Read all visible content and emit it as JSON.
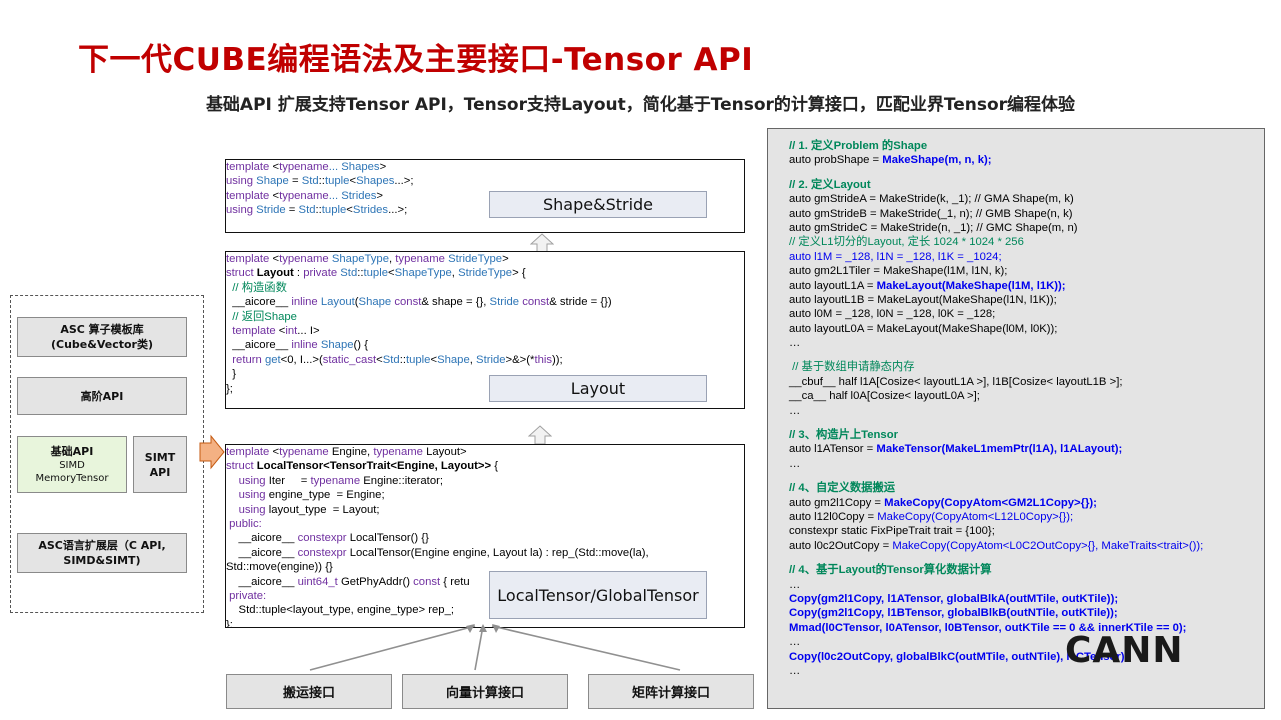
{
  "title": "下一代CUBE编程语法及主要接口-Tensor API",
  "subtitle": "基础API 扩展支持Tensor API，Tensor支持Layout，简化基于Tensor的计算接口，匹配业界Tensor编程体验",
  "arch": {
    "asc_lib": "ASC 算子模板库",
    "asc_lib_sub": "(Cube&Vector类)",
    "high_api": "高阶API",
    "basic_api": "基础API",
    "basic_api_simd": "SIMD",
    "basic_api_mem": "MemoryTensor",
    "simt_api_1": "SIMT",
    "simt_api_2": "API",
    "ext_layer_1": "ASC语言扩展层（C API,",
    "ext_layer_2": "SIMD&SIMT)"
  },
  "labels": {
    "shape_stride": "Shape&Stride",
    "layout": "Layout",
    "local_tensor": "LocalTensor/GlobalTensor"
  },
  "bottom_buttons": [
    "搬运接口",
    "向量计算接口",
    "矩阵计算接口"
  ],
  "code_shape": [
    [
      [
        "kw",
        "template "
      ],
      [
        "",
        "<"
      ],
      [
        "kw",
        "typename"
      ],
      [
        "ty",
        "... Shapes"
      ],
      [
        "",
        ">"
      ]
    ],
    [
      [
        "kw",
        "using "
      ],
      [
        "ty",
        "Shape"
      ],
      [
        "",
        " = "
      ],
      [
        "ty",
        "Std"
      ],
      [
        "",
        "::"
      ],
      [
        "ty",
        "tuple"
      ],
      [
        "",
        "<"
      ],
      [
        "ty",
        "Shapes"
      ],
      [
        "",
        "...>;"
      ]
    ],
    [
      [
        "kw",
        "template "
      ],
      [
        "",
        "<"
      ],
      [
        "kw",
        "typename"
      ],
      [
        "ty",
        "... Strides"
      ],
      [
        "",
        ">"
      ]
    ],
    [
      [
        "kw",
        "using "
      ],
      [
        "ty",
        "Stride"
      ],
      [
        "",
        " = "
      ],
      [
        "ty",
        "Std"
      ],
      [
        "",
        "::"
      ],
      [
        "ty",
        "tuple"
      ],
      [
        "",
        "<"
      ],
      [
        "ty",
        "Strides"
      ],
      [
        "",
        "...>;"
      ]
    ]
  ],
  "code_layout": [
    [
      [
        "kw",
        "template "
      ],
      [
        "",
        "<"
      ],
      [
        "kw",
        "typename "
      ],
      [
        "ty",
        "ShapeType"
      ],
      [
        "",
        ", "
      ],
      [
        "kw",
        "typename "
      ],
      [
        "ty",
        "StrideType"
      ],
      [
        "",
        ">"
      ]
    ],
    [
      [
        "kw",
        "struct "
      ],
      [
        "bold",
        "Layout"
      ],
      [
        "",
        " : "
      ],
      [
        "kw",
        "private "
      ],
      [
        "ty",
        "Std"
      ],
      [
        "",
        "::"
      ],
      [
        "ty",
        "tuple"
      ],
      [
        "",
        "<"
      ],
      [
        "ty",
        "ShapeType"
      ],
      [
        "",
        ", "
      ],
      [
        "ty",
        "StrideType"
      ],
      [
        "",
        "> {"
      ]
    ],
    [
      [
        "cm",
        "  // 构造函数"
      ]
    ],
    [
      [
        "",
        "  __aicore__ "
      ],
      [
        "kw",
        "inline "
      ],
      [
        "ty",
        "Layout"
      ],
      [
        "",
        "("
      ],
      [
        "ty",
        "Shape "
      ],
      [
        "kw",
        "const"
      ],
      [
        "",
        "& shape = {}, "
      ],
      [
        "ty",
        "Stride "
      ],
      [
        "kw",
        "const"
      ],
      [
        "",
        "& stride = {})"
      ]
    ],
    [
      [
        "cm",
        "  // 返回Shape"
      ]
    ],
    [
      [
        "",
        "  "
      ],
      [
        "kw",
        "template "
      ],
      [
        "",
        "<"
      ],
      [
        "kw",
        "int"
      ],
      [
        "",
        "... I>"
      ]
    ],
    [
      [
        "",
        "  __aicore__ "
      ],
      [
        "kw",
        "inline "
      ],
      [
        "ty",
        "Shape"
      ],
      [
        "",
        "() {"
      ]
    ],
    [
      [
        "",
        "  "
      ],
      [
        "kw",
        "return "
      ],
      [
        "ty",
        "get"
      ],
      [
        "",
        "<0, I...>("
      ],
      [
        "kw",
        "static_cast"
      ],
      [
        "",
        "<"
      ],
      [
        "ty",
        "Std"
      ],
      [
        "",
        "::"
      ],
      [
        "ty",
        "tuple"
      ],
      [
        "",
        "<"
      ],
      [
        "ty",
        "Shape"
      ],
      [
        "",
        ", "
      ],
      [
        "ty",
        "Stride"
      ],
      [
        "",
        ">&>(*"
      ],
      [
        "kw",
        "this"
      ],
      [
        "",
        "));"
      ]
    ],
    [
      [
        "",
        "  }"
      ]
    ],
    [
      [
        "",
        "};"
      ]
    ]
  ],
  "code_tensor": [
    [
      [
        "kw",
        "template "
      ],
      [
        "",
        "<"
      ],
      [
        "kw",
        "typename "
      ],
      [
        "",
        "Engine, "
      ],
      [
        "kw",
        "typename "
      ],
      [
        "",
        "Layout>"
      ]
    ],
    [
      [
        "kw",
        "struct "
      ],
      [
        "bold",
        "LocalTensor<TensorTrait<Engine, Layout>>"
      ],
      [
        "",
        " {"
      ]
    ],
    [
      [
        "",
        "    "
      ],
      [
        "kw",
        "using "
      ],
      [
        "",
        "Iter     = "
      ],
      [
        "kw",
        "typename "
      ],
      [
        "",
        "Engine::iterator;"
      ]
    ],
    [
      [
        "",
        "    "
      ],
      [
        "kw",
        "using "
      ],
      [
        "",
        "engine_type  = Engine;"
      ]
    ],
    [
      [
        "",
        "    "
      ],
      [
        "kw",
        "using "
      ],
      [
        "",
        "layout_type  = Layout;"
      ]
    ],
    [
      [
        "kw",
        " public:"
      ]
    ],
    [
      [
        "",
        "    __aicore__ "
      ],
      [
        "kw",
        "constexpr "
      ],
      [
        "",
        "LocalTensor() {}"
      ]
    ],
    [
      [
        "",
        "    __aicore__ "
      ],
      [
        "kw",
        "constexpr "
      ],
      [
        "",
        "LocalTensor(Engine engine, Layout la) : rep_(Std::move(la),"
      ]
    ],
    [
      [
        "",
        "Std::move(engine)) {}"
      ]
    ],
    [
      [
        "",
        "    __aicore__ "
      ],
      [
        "kw",
        "uint64_t "
      ],
      [
        "",
        "GetPhyAddr() "
      ],
      [
        "kw",
        "const "
      ],
      [
        "",
        "{ retu"
      ]
    ],
    [
      [
        "kw",
        " private:"
      ]
    ],
    [
      [
        "",
        "    Std::tuple<layout_type, engine_type> rep_;"
      ]
    ],
    [
      [
        "",
        "};"
      ]
    ]
  ],
  "right_code": [
    [
      [
        "r-cm",
        "// 1. 定义Problem 的Shape"
      ]
    ],
    [
      [
        "",
        "auto probShape = "
      ],
      [
        "r-blue",
        "MakeShape(m, n, k);"
      ]
    ],
    [],
    [
      [
        "r-cm",
        "// 2. 定义Layout"
      ]
    ],
    [
      [
        "",
        "auto gmStrideA = MakeStride(k, _1); // GMA Shape(m, k)"
      ]
    ],
    [
      [
        "",
        "auto gmStrideB = MakeStride(_1, n); // GMB Shape(n, k)"
      ]
    ],
    [
      [
        "",
        "auto gmStrideC = MakeStride(n, _1); // GMC Shape(m, n)"
      ]
    ],
    [
      [
        "r-cm2",
        "// 定义L1切分的Layout, 定长 1024 * 1024 * 256"
      ]
    ],
    [
      [
        "r-blue2",
        "auto l1M = _128, l1N = _128, l1K = _1024;"
      ]
    ],
    [
      [
        "",
        "auto gm2L1Tiler = MakeShape(l1M, l1N, k);"
      ]
    ],
    [
      [
        "",
        "auto layoutL1A = "
      ],
      [
        "r-blue",
        "MakeLayout(MakeShape(l1M, l1K));"
      ]
    ],
    [
      [
        "",
        "auto layoutL1B = MakeLayout(MakeShape(l1N, l1K));"
      ]
    ],
    [
      [
        "",
        "auto l0M = _128, l0N = _128, l0K = _128;"
      ]
    ],
    [
      [
        "",
        "auto layoutL0A = MakeLayout(MakeShape(l0M, l0K));"
      ]
    ],
    [
      [
        "",
        "…"
      ]
    ],
    [],
    [
      [
        "r-cm2",
        " // 基于数组申请静态内存"
      ]
    ],
    [
      [
        "",
        "__cbuf__ half l1A[Cosize< layoutL1A >], l1B[Cosize< layoutL1B >];"
      ]
    ],
    [
      [
        "",
        "__ca__ half l0A[Cosize< layoutL0A >];"
      ]
    ],
    [
      [
        "",
        "…"
      ]
    ],
    [],
    [
      [
        "r-cm",
        "// 3、构造片上Tensor"
      ]
    ],
    [
      [
        "",
        "auto l1ATensor = "
      ],
      [
        "r-blue",
        "MakeTensor(MakeL1memPtr(l1A), l1ALayout);"
      ]
    ],
    [
      [
        "",
        "…"
      ]
    ],
    [],
    [
      [
        "r-cm",
        "// 4、自定义数据搬运"
      ]
    ],
    [
      [
        "",
        "auto gm2l1Copy = "
      ],
      [
        "r-blue",
        "MakeCopy(CopyAtom<GM2L1Copy>{});"
      ]
    ],
    [
      [
        "",
        "auto l12l0Copy = "
      ],
      [
        "r-blue2",
        "MakeCopy(CopyAtom<L12L0Copy>{});"
      ]
    ],
    [
      [
        "",
        "constexpr static FixPipeTrait trait = {100};"
      ]
    ],
    [
      [
        "",
        "auto l0c2OutCopy = "
      ],
      [
        "r-blue2",
        "MakeCopy(CopyAtom<L0C2OutCopy>{}, MakeTraits<trait>());"
      ]
    ],
    [],
    [
      [
        "r-cm",
        "// 4、基于Layout的Tensor算化数据计算"
      ]
    ],
    [
      [
        "",
        "…"
      ]
    ],
    [
      [
        "r-blue",
        "Copy(gm2l1Copy, l1ATensor, globalBlkA(outMTile, outKTile));"
      ]
    ],
    [
      [
        "r-blue",
        "Copy(gm2l1Copy, l1BTensor, globalBlkB(outNTile, outKTile));"
      ]
    ],
    [
      [
        "r-blue",
        "Mmad(l0CTensor, l0ATensor, l0BTensor, outKTile == 0 && innerKTile == 0);"
      ]
    ],
    [
      [
        "",
        "…"
      ]
    ],
    [
      [
        "r-blue",
        "Copy(l0c2OutCopy, globalBlkC(outMTile, outNTile), l0CTensor);"
      ]
    ],
    [
      [
        "",
        "…"
      ]
    ]
  ],
  "logo": "CANN",
  "colors": {
    "title": "#c00000",
    "comment": "#00875a",
    "keyword": "#7030a0",
    "type": "#2e75b6",
    "api_blue": "#0000ee",
    "arrow": "#f4b183"
  }
}
